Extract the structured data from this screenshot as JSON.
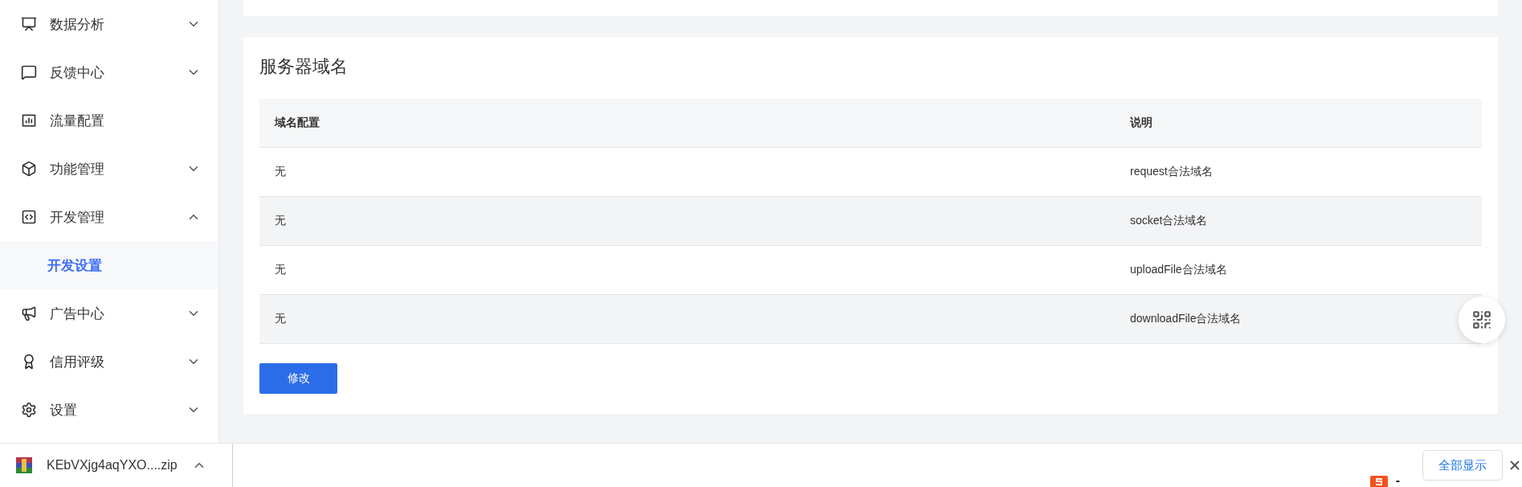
{
  "sidebar": {
    "items": [
      {
        "label": "数据分析",
        "kind": "group",
        "expanded": false,
        "selected": false
      },
      {
        "label": "反馈中心",
        "kind": "group",
        "expanded": false,
        "selected": false
      },
      {
        "label": "流量配置",
        "kind": "link",
        "selected": false
      },
      {
        "label": "功能管理",
        "kind": "group",
        "expanded": false,
        "selected": false
      },
      {
        "label": "开发管理",
        "kind": "group",
        "expanded": true,
        "selected": false,
        "children": [
          {
            "label": "开发设置",
            "selected": true
          }
        ]
      },
      {
        "label": "广告中心",
        "kind": "group",
        "expanded": false,
        "selected": false
      },
      {
        "label": "信用评级",
        "kind": "group",
        "expanded": false,
        "selected": false
      },
      {
        "label": "设置",
        "kind": "group",
        "expanded": false,
        "selected": false
      }
    ]
  },
  "section": {
    "title": "服务器域名",
    "table": {
      "columns": [
        "域名配置",
        "说明"
      ],
      "rows": [
        [
          "无",
          "request合法域名"
        ],
        [
          "无",
          "socket合法域名"
        ],
        [
          "无",
          "uploadFile合法域名"
        ],
        [
          "无",
          "downloadFile合法域名"
        ]
      ]
    },
    "button": "修改"
  },
  "download_bar": {
    "file": "KEbVXjg4aqYXO....zip",
    "show_all": "全部显示",
    "tray_text": "-"
  }
}
